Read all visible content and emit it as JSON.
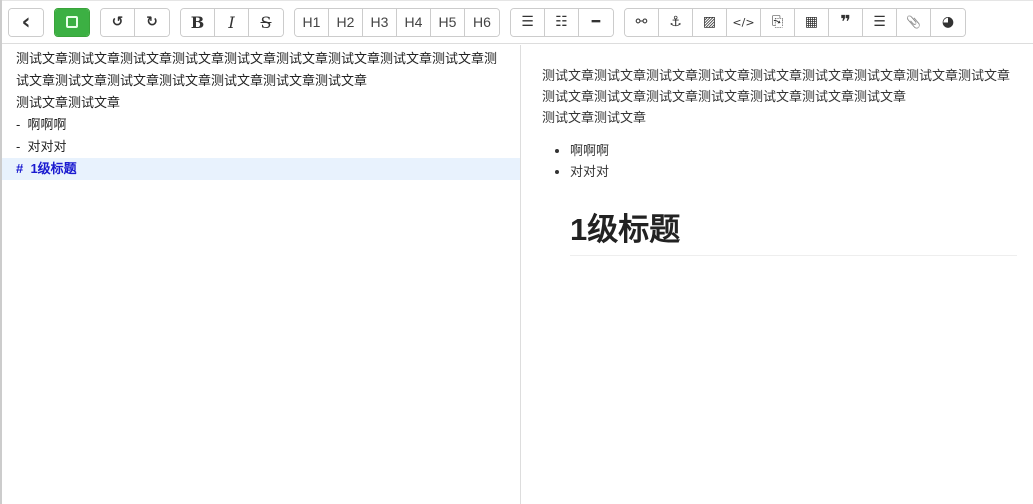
{
  "toolbar": {
    "back_icon": "‹",
    "save_icon": "💾",
    "undo_icon": "↺",
    "redo_icon": "↻",
    "bold": "B",
    "italic": "I",
    "strike": "S",
    "headings": [
      "H1",
      "H2",
      "H3",
      "H4",
      "H5",
      "H6"
    ],
    "ul_icon": "☰",
    "ol_icon": "☷",
    "hr_icon": "━",
    "link_icon": "⚯",
    "anchor_icon": "⚓",
    "image_icon": "▨",
    "code_icon": "</>",
    "codeblock_icon": "⎘",
    "table_icon": "▦",
    "quote_icon": "❞",
    "toc_icon": "☰",
    "attach_icon": "📎",
    "emoji_icon": "◕"
  },
  "editor": {
    "lines": [
      "测试文章测试文章测试文章测试文章测试文章测试文章测试文章测试文章测试文章测试文章测试文章测试文章测试文章测试文章测试文章测试文章",
      "测试文章测试文章",
      "-  啊啊啊",
      "-  对对对",
      "#  1级标题"
    ]
  },
  "preview": {
    "paragraph": "测试文章测试文章测试文章测试文章测试文章测试文章测试文章测试文章测试文章测试文章测试文章测试文章测试文章测试文章测试文章测试文章",
    "paragraph2": "测试文章测试文章",
    "list": [
      "啊啊啊",
      "对对对"
    ],
    "heading": "1级标题"
  }
}
